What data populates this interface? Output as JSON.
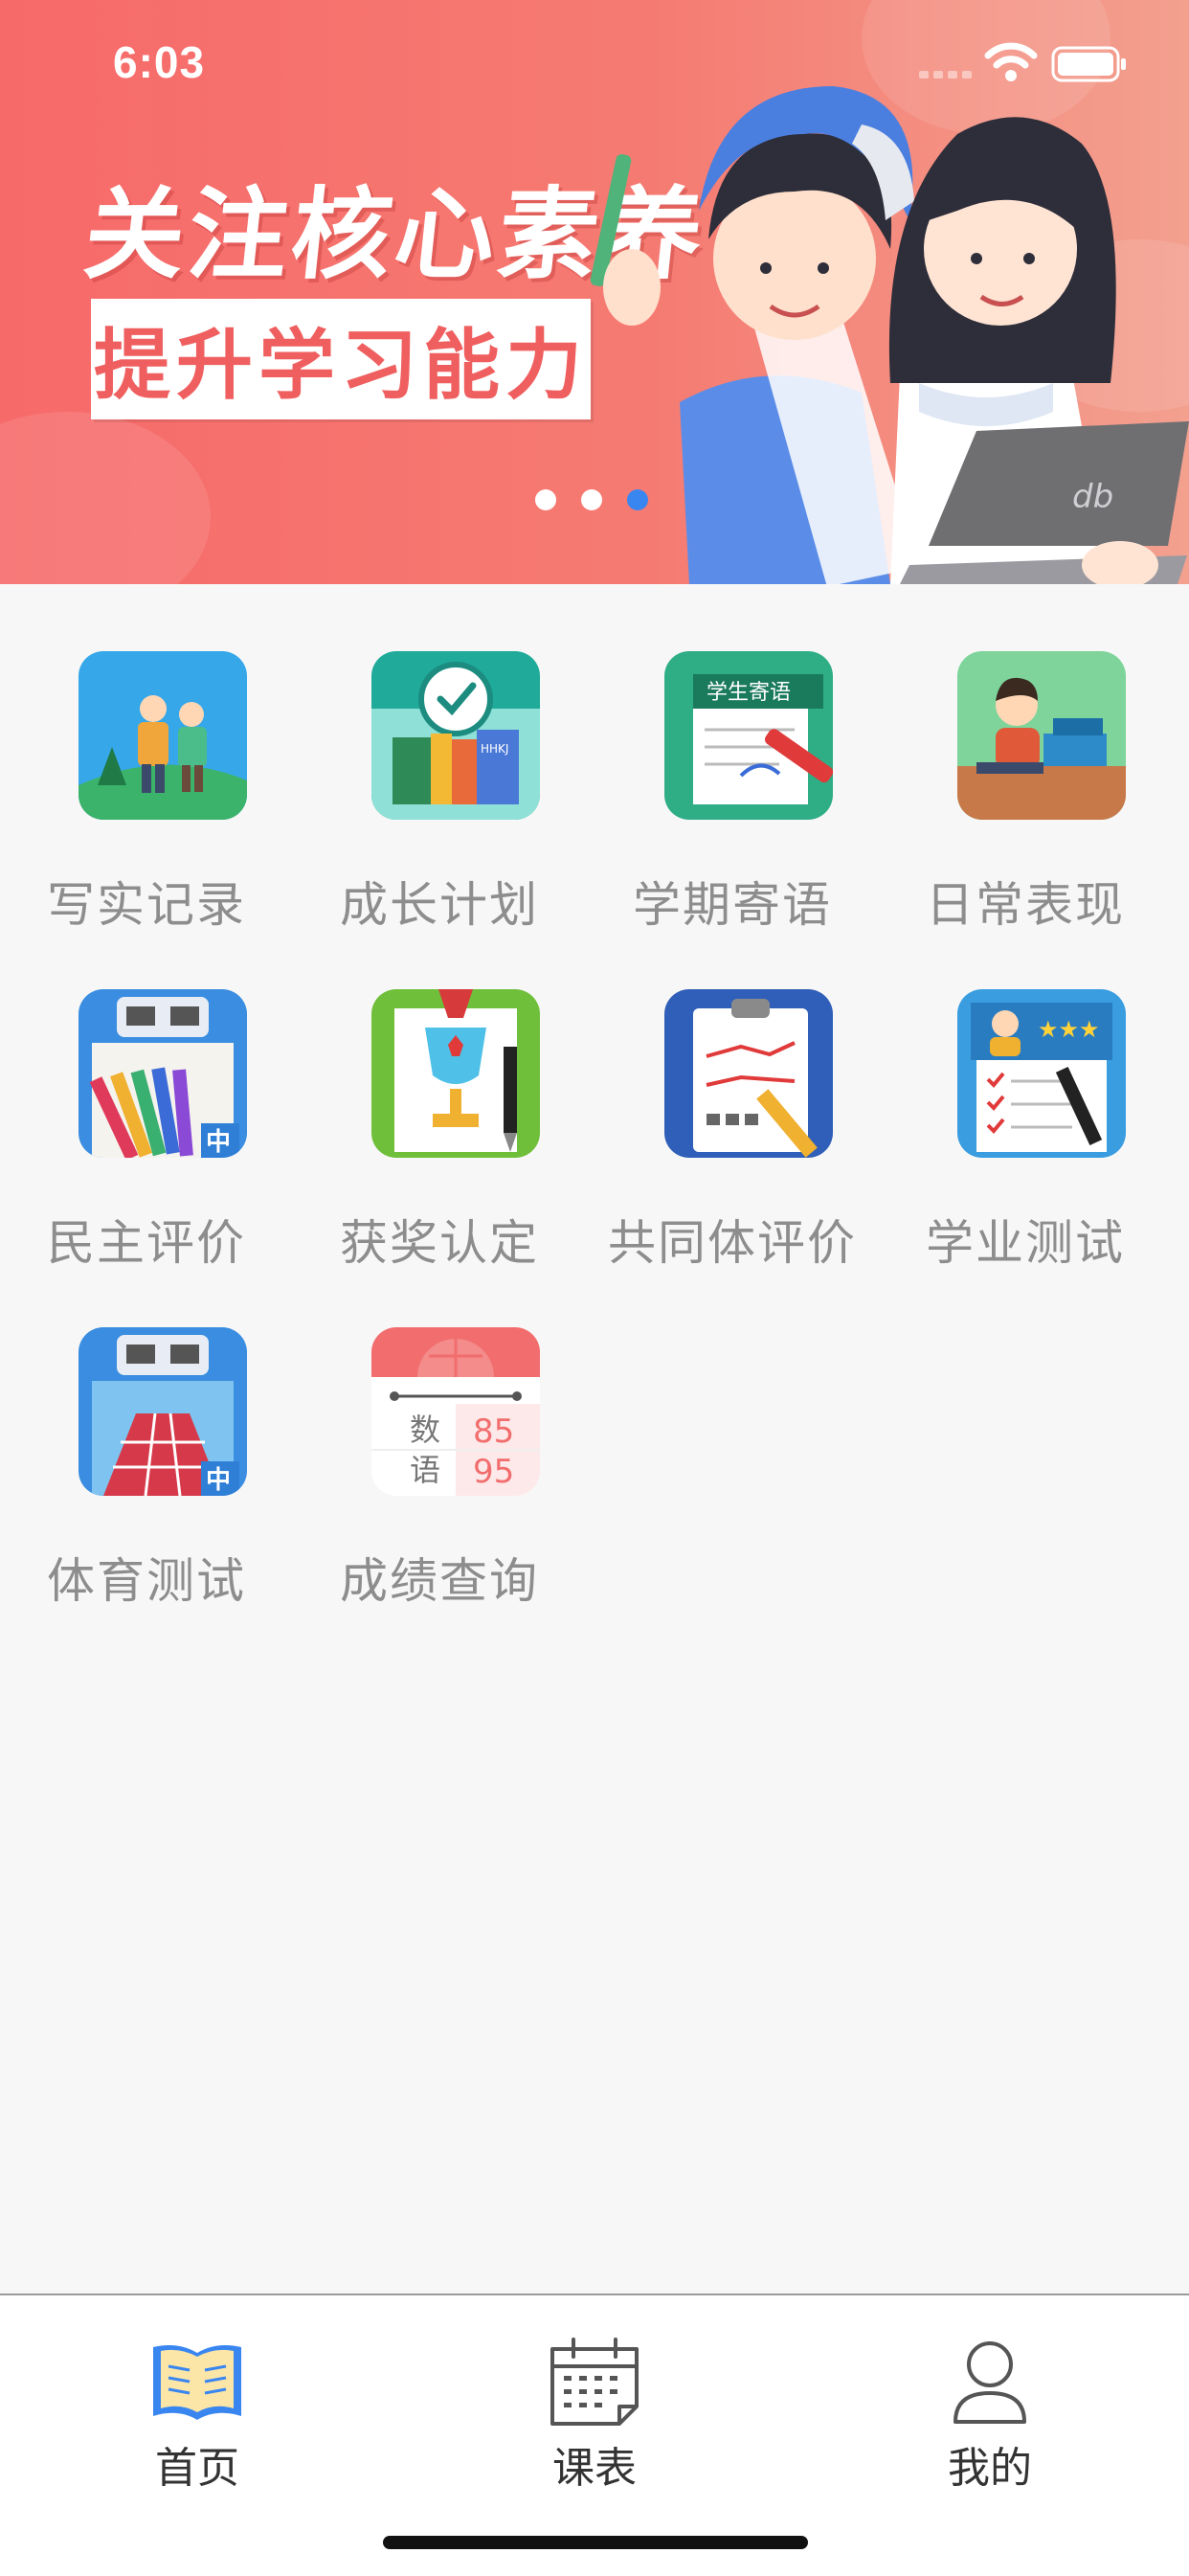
{
  "status_bar": {
    "time": "6:03"
  },
  "banner": {
    "title": "关注核心素养",
    "subtitle": "提升学习能力",
    "dots_total": 3,
    "active_dot": 3
  },
  "features": [
    {
      "label": "写实记录",
      "icon": "hiking-students-icon"
    },
    {
      "label": "成长计划",
      "icon": "clock-books-icon"
    },
    {
      "label": "学期寄语",
      "icon": "message-pen-icon"
    },
    {
      "label": "日常表现",
      "icon": "student-reading-icon"
    },
    {
      "label": "民主评价",
      "icon": "pencils-board-icon"
    },
    {
      "label": "获奖认定",
      "icon": "trophy-certificate-icon"
    },
    {
      "label": "共同体评价",
      "icon": "clipboard-chart-icon"
    },
    {
      "label": "学业测试",
      "icon": "profile-checklist-icon"
    },
    {
      "label": "体育测试",
      "icon": "running-track-icon"
    },
    {
      "label": "成绩查询",
      "icon": "score-card-icon",
      "card_rows": [
        {
          "subject": "数",
          "score": "85"
        },
        {
          "subject": "语",
          "score": "95"
        }
      ]
    }
  ],
  "tab_bar": {
    "tabs": [
      {
        "label": "首页",
        "icon": "open-book-icon",
        "active": true
      },
      {
        "label": "课表",
        "icon": "calendar-icon",
        "active": false
      },
      {
        "label": "我的",
        "icon": "person-icon",
        "active": false
      }
    ]
  },
  "colors": {
    "banner": "#f76a6a",
    "accent": "#3a86f0",
    "label_gray": "#8d8d8d"
  }
}
